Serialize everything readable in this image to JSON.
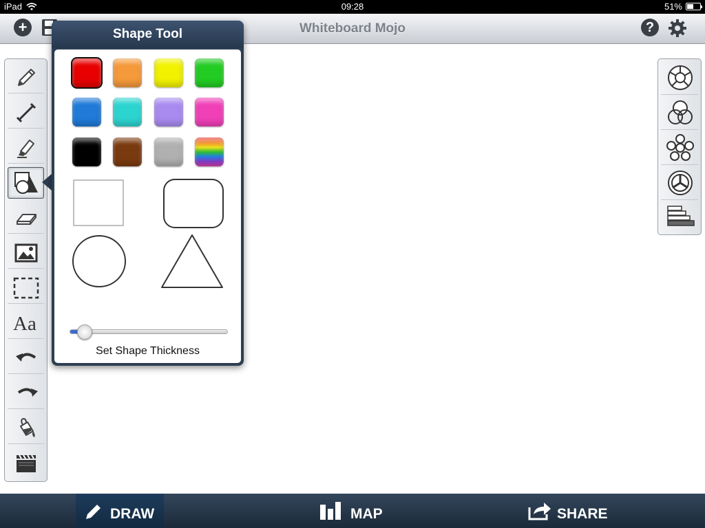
{
  "status_bar": {
    "device": "iPad",
    "time": "09:28",
    "battery": "51%",
    "battery_level": 0.51
  },
  "nav": {
    "title": "Whiteboard Mojo",
    "add_icon": "plus-circle-icon",
    "save_icon": "floppy-disk-icon",
    "help_icon": "help-icon",
    "settings_icon": "gear-icon"
  },
  "left_tools": [
    {
      "icon": "pencil-icon"
    },
    {
      "icon": "line-icon"
    },
    {
      "icon": "highlighter-icon"
    },
    {
      "icon": "shape-tool-icon",
      "selected": true
    },
    {
      "icon": "eraser-icon"
    },
    {
      "icon": "image-icon"
    },
    {
      "icon": "selection-icon"
    },
    {
      "icon": "text-icon",
      "label": "Aa"
    },
    {
      "icon": "undo-icon"
    },
    {
      "icon": "redo-icon"
    },
    {
      "icon": "fill-bucket-icon"
    },
    {
      "icon": "clapperboard-icon"
    }
  ],
  "right_tools": [
    {
      "icon": "cycle-diagram-icon"
    },
    {
      "icon": "venn-diagram-icon"
    },
    {
      "icon": "radial-diagram-icon"
    },
    {
      "icon": "pie-diagram-icon"
    },
    {
      "icon": "pyramid-stack-icon"
    }
  ],
  "shape_tool": {
    "title": "Shape Tool",
    "colors": [
      "#e80000",
      "#f59a3a",
      "#f2f200",
      "#22cc22",
      "#1f7ad8",
      "#2cd4d0",
      "#a98bf0",
      "#f040b8",
      "#000000",
      "#7a3a10",
      "#b0b0b0",
      "rainbow"
    ],
    "selected_color": 0,
    "shapes": [
      "square",
      "rounded-rectangle",
      "circle",
      "triangle"
    ],
    "thickness_label": "Set Shape Thickness",
    "thickness_value": 0.09
  },
  "bottom_bar": {
    "draw": "DRAW",
    "map": "MAP",
    "share": "SHARE",
    "active": "draw"
  }
}
